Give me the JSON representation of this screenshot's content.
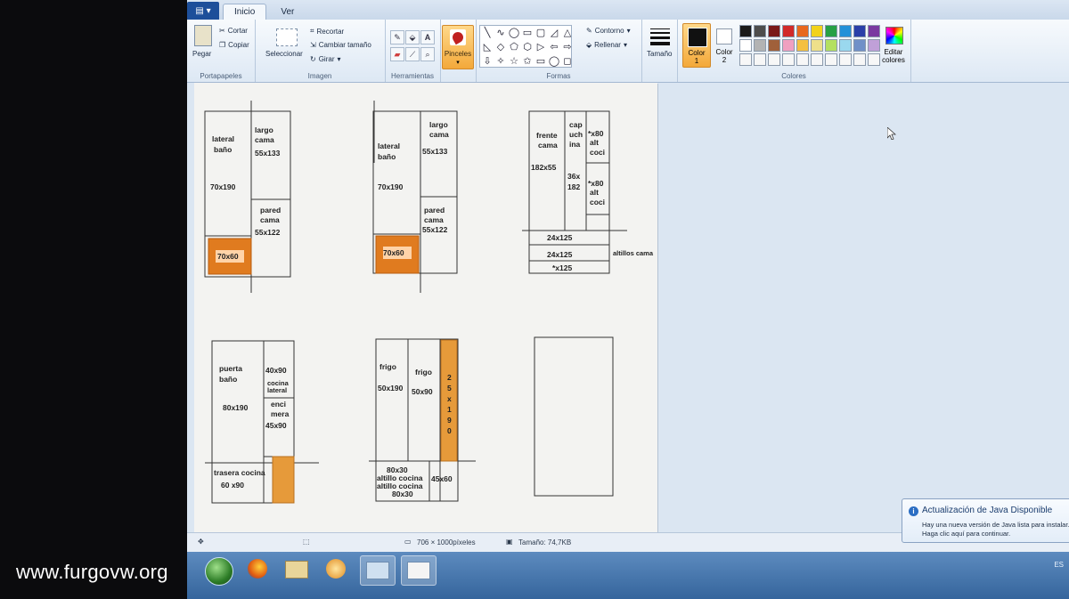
{
  "menubar": {
    "tabs": [
      "Inicio",
      "Ver"
    ]
  },
  "ribbon": {
    "clipboard": {
      "paste": "Pegar",
      "cut": "Cortar",
      "copy": "Copiar",
      "label": "Portapapeles"
    },
    "image": {
      "select": "Seleccionar",
      "crop": "Recortar",
      "resize": "Cambiar tamaño",
      "rotate": "Girar",
      "label": "Imagen"
    },
    "tools": {
      "label": "Herramientas",
      "text_tool": "A"
    },
    "brushes": {
      "label": "Pinceles"
    },
    "shapes": {
      "outline": "Contorno",
      "fill": "Rellenar",
      "label": "Formas"
    },
    "size": {
      "label": "Tamaño"
    },
    "colors": {
      "color1_line1": "Color",
      "color1_line2": "1",
      "color2_line1": "Color",
      "color2_line2": "2",
      "edit_line1": "Editar",
      "edit_line2": "colores",
      "label": "Colores",
      "palette": [
        "#1a1a1a",
        "#4d4d4d",
        "#7a1a1a",
        "#d12a2a",
        "#e8681f",
        "#f2d21a",
        "#27a044",
        "#2390d8",
        "#2a3fa8",
        "#7a3aa0",
        "#ffffff",
        "#b3b3b3",
        "#a0603a",
        "#f0a0c0",
        "#f5c040",
        "#eee08a",
        "#b4e060",
        "#9ad8ee",
        "#7090c8",
        "#c0a0d8",
        "#f7f7f7",
        "#f7f7f7",
        "#f7f7f7",
        "#f7f7f7",
        "#f7f7f7",
        "#f7f7f7",
        "#f7f7f7",
        "#f7f7f7",
        "#f7f7f7",
        "#f7f7f7"
      ]
    }
  },
  "drawing": {
    "d1": {
      "lateral": "lateral",
      "bano": "baño",
      "dim_lat": "70x190",
      "largo": "largo",
      "cama": "cama",
      "dim_largo": "55x133",
      "pared": "pared",
      "cama2": "cama",
      "dim_pared": "55x122",
      "orange": "70x60"
    },
    "d2": {
      "lateral": "lateral",
      "bano": "baño",
      "dim_lat": "70x190",
      "largo": "largo",
      "cama": "cama",
      "dim_largo": "55x133",
      "pared": "pared",
      "cama2": "cama",
      "dim_pared": "55x122",
      "orange": "70x60"
    },
    "d3": {
      "frente": "frente",
      "cama": "cama",
      "dim_frente": "182x55",
      "cap": "cap",
      "uch": "uch",
      "ina": "ina",
      "cap_dim1": "36x",
      "cap_dim2": "182",
      "x80a": "*x80",
      "alt_a": "alt",
      "coci_a": "coci",
      "x80b": "*x80",
      "alt_b": "alt",
      "coci_b": "coci",
      "r1": "24x125",
      "r2": "24x125",
      "r3": "*x125",
      "altillos": "altillos cama"
    },
    "d4": {
      "puerta": "puerta",
      "bano": "baño",
      "dim_puerta": "80x190",
      "dim_top": "40x90",
      "cocina": "cocina",
      "lateral": "lateral",
      "enci": "enci",
      "mera": "mera",
      "dim_enci": "45x90",
      "trasera": "trasera cocina",
      "dim_trasera": "60 x90"
    },
    "d5": {
      "frigo1": "frigo",
      "dim_f1": "50x190",
      "frigo2": "frigo",
      "dim_f2": "50x90",
      "vertical": [
        "2",
        "5",
        "x",
        "1",
        "9",
        "0"
      ],
      "b1": "80x30",
      "b2": "altillo cocina",
      "b3": "altillo cocina",
      "b4": "80x30",
      "b5": "45x60"
    }
  },
  "statusbar": {
    "dimensions": "706 × 1000píxeles",
    "size": "Tamaño: 74,7KB"
  },
  "notification": {
    "title": "Actualización de Java Disponible",
    "line1": "Hay una nueva versión de Java lista para instalar.",
    "line2": "Haga clic aquí para continuar."
  },
  "taskbar": {
    "lang": "ES"
  },
  "watermark": "www.furgovw.org"
}
